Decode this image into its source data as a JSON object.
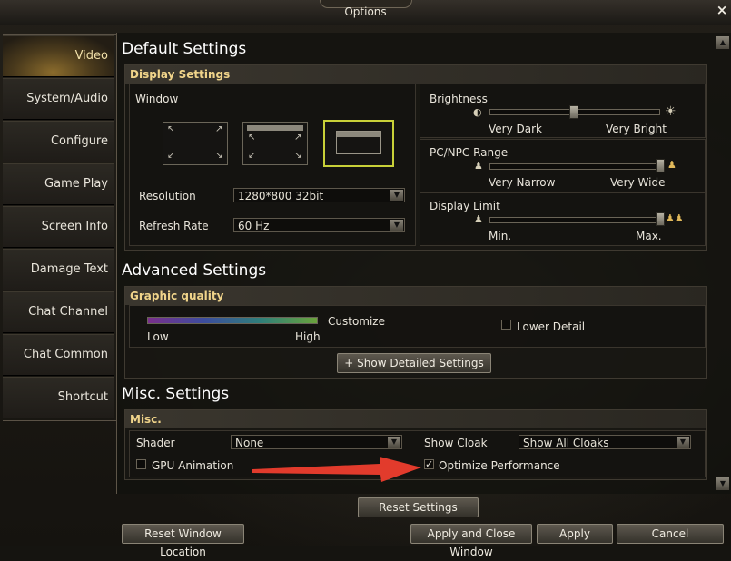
{
  "window": {
    "title": "Options",
    "close_icon": "×"
  },
  "sidebar": {
    "items": [
      {
        "label": "Video",
        "active": true
      },
      {
        "label": "System/Audio"
      },
      {
        "label": "Configure"
      },
      {
        "label": "Game Play"
      },
      {
        "label": "Screen Info"
      },
      {
        "label": "Damage Text"
      },
      {
        "label": "Chat Channel"
      },
      {
        "label": "Chat Common"
      },
      {
        "label": "Shortcut"
      }
    ]
  },
  "default_settings": {
    "title": "Default Settings",
    "display_settings": {
      "header": "Display Settings",
      "window_label": "Window",
      "window_modes": [
        "fullscreen",
        "windowed-fullscreen",
        "windowed"
      ],
      "selected_mode": "windowed",
      "resolution_label": "Resolution",
      "resolution_value": "1280*800 32bit",
      "refresh_label": "Refresh Rate",
      "refresh_value": "60 Hz"
    },
    "brightness": {
      "label": "Brightness",
      "min": "Very Dark",
      "max": "Very Bright",
      "value": 0.5
    },
    "pc_npc_range": {
      "label": "PC/NPC Range",
      "min": "Very Narrow",
      "max": "Very Wide",
      "value": 1.0
    },
    "display_limit": {
      "label": "Display Limit",
      "min": "Min.",
      "max": "Max.",
      "value": 1.0
    }
  },
  "advanced_settings": {
    "title": "Advanced Settings",
    "graphic_quality": {
      "header": "Graphic quality",
      "low": "Low",
      "high": "High",
      "mode": "Customize",
      "lower_detail_label": "Lower Detail",
      "lower_detail_checked": false,
      "show_detailed_label": "+ Show Detailed Settings"
    }
  },
  "misc_settings": {
    "title": "Misc. Settings",
    "header": "Misc.",
    "shader_label": "Shader",
    "shader_value": "None",
    "show_cloak_label": "Show Cloak",
    "show_cloak_value": "Show All Cloaks",
    "gpu_animation_label": "GPU Animation",
    "gpu_animation_checked": false,
    "optimize_label": "Optimize Performance",
    "optimize_checked": true
  },
  "footer": {
    "reset_settings": "Reset Settings",
    "reset_window_location": "Reset Window Location",
    "apply_and_close": "Apply and Close Window",
    "apply": "Apply",
    "cancel": "Cancel"
  },
  "colors": {
    "accent_gold": "#f0d48a",
    "selected_outline": "#c8d038",
    "annotation_arrow": "#e23b2c"
  }
}
